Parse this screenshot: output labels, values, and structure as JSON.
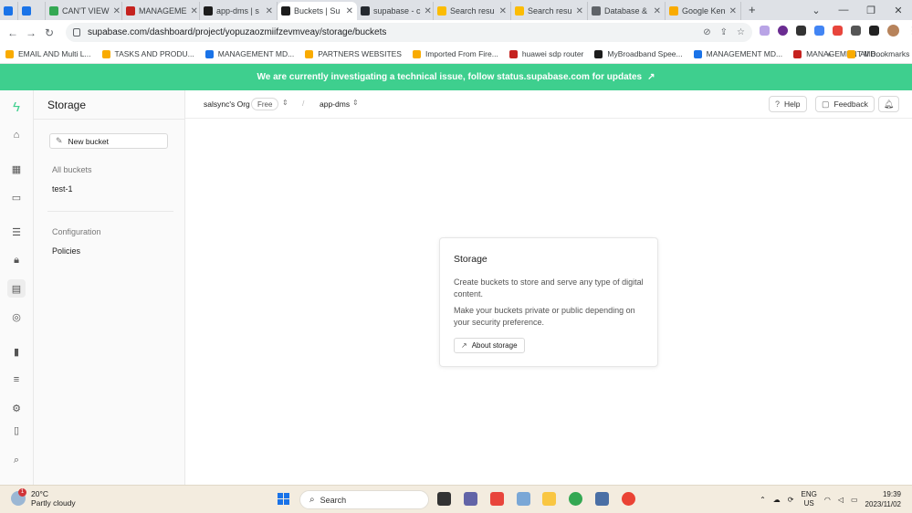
{
  "browser": {
    "tabs": [
      {
        "label": "",
        "color": "#1a73e8"
      },
      {
        "label": "",
        "color": "#1a73e8"
      },
      {
        "label": "CAN'T VIEW",
        "color": "#34a853"
      },
      {
        "label": "MANAGEME",
        "color": "#c5221f"
      },
      {
        "label": "app-dms | s",
        "color": "#1c1c1c"
      },
      {
        "label": "Buckets | Su",
        "color": "#1c1c1c",
        "active": true
      },
      {
        "label": "supabase - c",
        "color": "#24292f"
      },
      {
        "label": "Search resu",
        "color": "#fbbc04"
      },
      {
        "label": "Search resu",
        "color": "#fbbc04"
      },
      {
        "label": "Database &",
        "color": "#5f6368"
      },
      {
        "label": "Google Ken",
        "color": "#f9ab00"
      }
    ],
    "new_tab": "+",
    "url": "supabase.com/dashboard/project/yopuzaozmiifzevmveay/storage/buckets",
    "bookmarks": [
      {
        "label": "EMAIL AND Multi L...",
        "color": "#f9ab00"
      },
      {
        "label": "TASKS AND PRODU...",
        "color": "#f9ab00"
      },
      {
        "label": "MANAGEMENT MD...",
        "color": "#1a73e8"
      },
      {
        "label": "PARTNERS WEBSITES",
        "color": "#f9ab00"
      },
      {
        "label": "Imported From Fire...",
        "color": "#f9ab00"
      },
      {
        "label": "huawei sdp router",
        "color": "#c5221f"
      },
      {
        "label": "MyBroadband Spee...",
        "color": "#1c1c1c"
      },
      {
        "label": "MANAGEMENT MD...",
        "color": "#1a73e8"
      },
      {
        "label": "MANAGEMENT MD...",
        "color": "#c5221f"
      }
    ],
    "more_bookmarks": "»",
    "all_bookmarks": "All Bookmarks"
  },
  "banner": {
    "text": "We are currently investigating a technical issue, follow status.supabase.com for updates",
    "color": "#3ecf8e"
  },
  "sidebar": {
    "title": "Storage",
    "new_bucket": "New bucket",
    "all_buckets_heading": "All buckets",
    "buckets": [
      "test-1"
    ],
    "configuration_heading": "Configuration",
    "config_items": [
      "Policies"
    ]
  },
  "topbar": {
    "org": "salsync's Org",
    "plan": "Free",
    "separator": "/",
    "project": "app-dms",
    "help": "Help",
    "feedback": "Feedback"
  },
  "card": {
    "title": "Storage",
    "para1": "Create buckets to store and serve any type of digital content.",
    "para2": "Make your buckets private or public depending on your security preference.",
    "button": "About storage"
  },
  "taskbar": {
    "temp": "20°C",
    "weather": "Partly cloudy",
    "weather_badge": "1",
    "search": "Search",
    "lang1": "ENG",
    "lang2": "US",
    "time": "19:39",
    "date": "2023/11/02"
  }
}
